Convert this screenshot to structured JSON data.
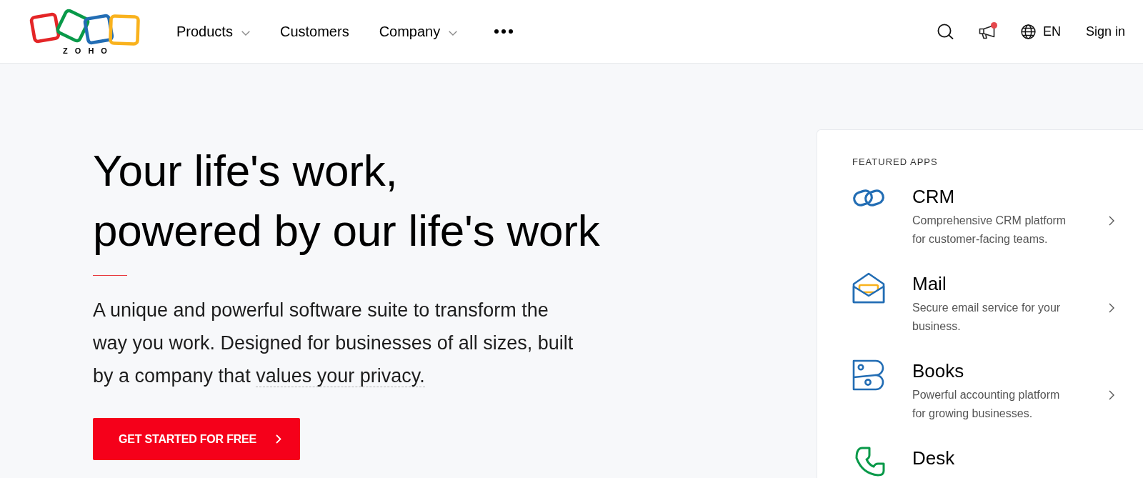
{
  "header": {
    "logo": {
      "text": "ZOHO"
    },
    "nav": [
      {
        "label": "Products",
        "dropdown": true
      },
      {
        "label": "Customers",
        "dropdown": false
      },
      {
        "label": "Company",
        "dropdown": true
      }
    ],
    "tools": {
      "announcements_unread": true,
      "language": "EN",
      "sign_in": "Sign in"
    }
  },
  "hero": {
    "heading_lines": [
      "Your life's work,",
      "powered by our life's work"
    ],
    "intro": "A unique and powerful software suite to transform the way you work. Designed for businesses of all sizes, built by a company that",
    "intro_link": "values your privacy.",
    "cta": "GET STARTED FOR FREE"
  },
  "featured_apps": {
    "title": "FEATURED APPS",
    "apps": [
      {
        "name": "CRM",
        "description": "Comprehensive CRM platform for customer-facing teams."
      },
      {
        "name": "Mail",
        "description": "Secure email service for your business."
      },
      {
        "name": "Books",
        "description": "Powerful accounting platform for growing businesses."
      },
      {
        "name": "Desk"
      }
    ]
  }
}
